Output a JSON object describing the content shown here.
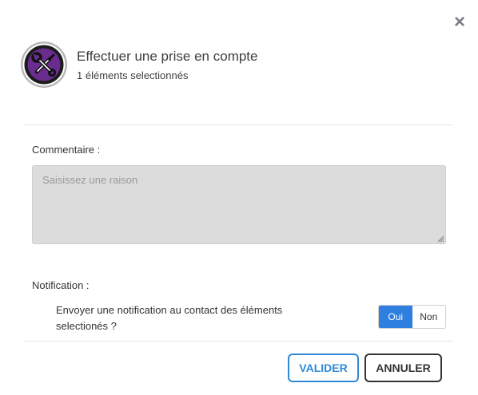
{
  "dialog": {
    "title": "Effectuer une prise en compte",
    "subtitle": "1 éléments selectionnés",
    "close_icon": "close-icon",
    "avatar_icon": "wrench-screwdriver-icon",
    "accent_color": "#6a2c8e"
  },
  "comment": {
    "label": "Commentaire :",
    "placeholder": "Saisissez une raison",
    "value": ""
  },
  "notification": {
    "label": "Notification :",
    "text": "Envoyer une notification au contact des éléments selectionés ?",
    "options": [
      "Oui",
      "Non"
    ],
    "selected": "Oui",
    "active_color": "#2f7fe0"
  },
  "actions": {
    "validate_label": "VALIDER",
    "cancel_label": "ANNULER",
    "validate_color": "#2f88d8"
  }
}
